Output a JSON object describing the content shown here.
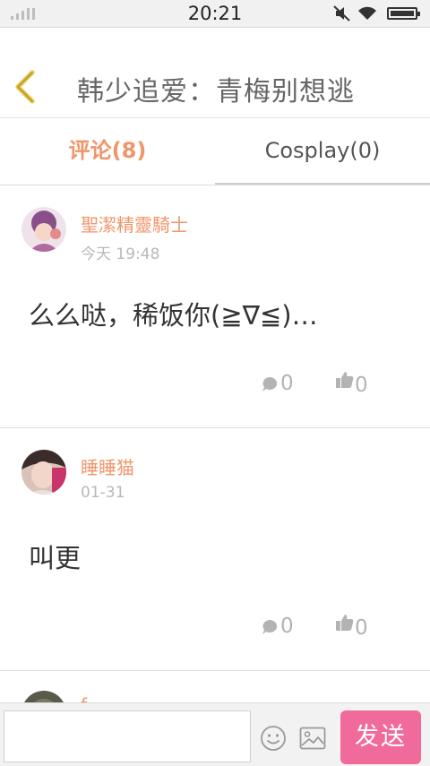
{
  "status_bar": {
    "time": "20:21"
  },
  "header": {
    "title": "韩少追爱：青梅别想逃",
    "back_icon": "chevron-left-icon",
    "accent": "#e6c23a"
  },
  "tabs": [
    {
      "label": "评论(8)",
      "active": true
    },
    {
      "label": "Cosplay(0)",
      "active": false
    }
  ],
  "comments": [
    {
      "username": "聖潔精靈騎士",
      "time": "今天 19:48",
      "text": "么么哒，稀饭你(≧∇≦)…",
      "replies": "0",
      "likes": "0"
    },
    {
      "username": "睡睡猫",
      "time": "01-31",
      "text": "叫更",
      "replies": "0",
      "likes": "0"
    },
    {
      "username": "f",
      "time": "",
      "text": "",
      "replies": "",
      "likes": ""
    }
  ],
  "input_bar": {
    "placeholder": "",
    "send_label": "发送",
    "send_color": "#f06b9b"
  },
  "colors": {
    "accent_orange": "#f0956a",
    "muted": "#b8b8b8"
  }
}
